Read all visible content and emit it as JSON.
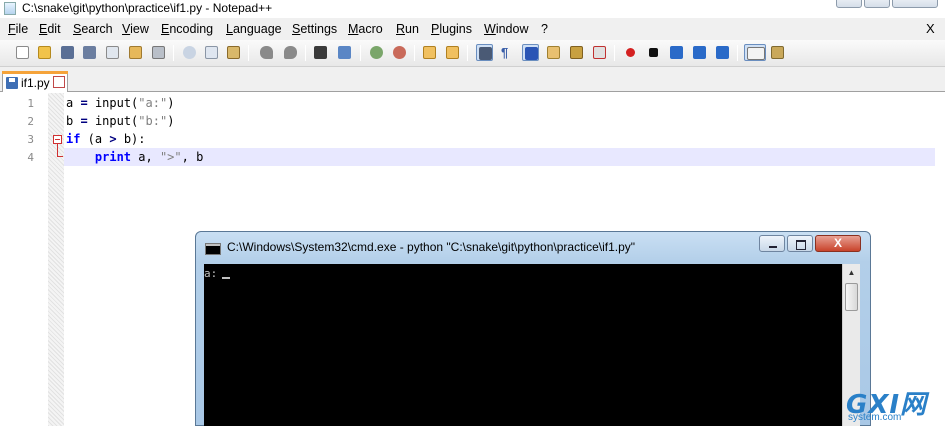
{
  "window": {
    "title": "C:\\snake\\git\\python\\practice\\if1.py - Notepad++"
  },
  "menu": {
    "items": [
      "File",
      "Edit",
      "Search",
      "View",
      "Encoding",
      "Language",
      "Settings",
      "Macro",
      "Run",
      "Plugins",
      "Window",
      "?"
    ],
    "doc_close": "X"
  },
  "toolbar": {
    "buttons": [
      "new",
      "open",
      "save",
      "save-all",
      "close",
      "close-all",
      "print",
      "cut",
      "copy",
      "paste",
      "undo",
      "redo",
      "find",
      "replace",
      "zoom-in",
      "zoom-out",
      "sync-vertical",
      "sync-horizontal",
      "word-wrap",
      "show-all-chars",
      "indent-guide",
      "user-defined-language",
      "doc-map",
      "function-list",
      "record-macro",
      "stop-recording",
      "playback",
      "run-macro-multiple",
      "save-macro",
      "spell-check",
      "plugin"
    ]
  },
  "tabs": [
    {
      "label": "if1.py",
      "close": "⊠"
    }
  ],
  "editor": {
    "line_numbers": [
      "1",
      "2",
      "3",
      "4"
    ],
    "lines": [
      {
        "a": "a",
        "eq": "=",
        "fn": "input(",
        "str": "\"a:\"",
        "close": ")"
      },
      {
        "a": "b",
        "eq": "=",
        "fn": "input(",
        "str": "\"b:\"",
        "close": ")"
      },
      {
        "kw": "if",
        "rest1": " (a ",
        "op": ">",
        "rest2": " b):"
      },
      {
        "indent": "    ",
        "kw": "print",
        "rest1": " a, ",
        "str": "\">\"",
        "rest2": ", b"
      }
    ],
    "current_line": 4
  },
  "cmd": {
    "title": "C:\\Windows\\System32\\cmd.exe - python  \"C:\\snake\\git\\python\\practice\\if1.py\"",
    "output": "a:",
    "close_glyph": "X",
    "scroll_up": "▲"
  },
  "watermark": {
    "text": "GXI网",
    "sub": "system.com"
  },
  "colors": {
    "keyword": "#0000ff",
    "string": "#808080",
    "operator": "#000080",
    "current_line": "#e8e8ff",
    "tab_accent": "#f5a33a",
    "console_bg": "#000000"
  }
}
